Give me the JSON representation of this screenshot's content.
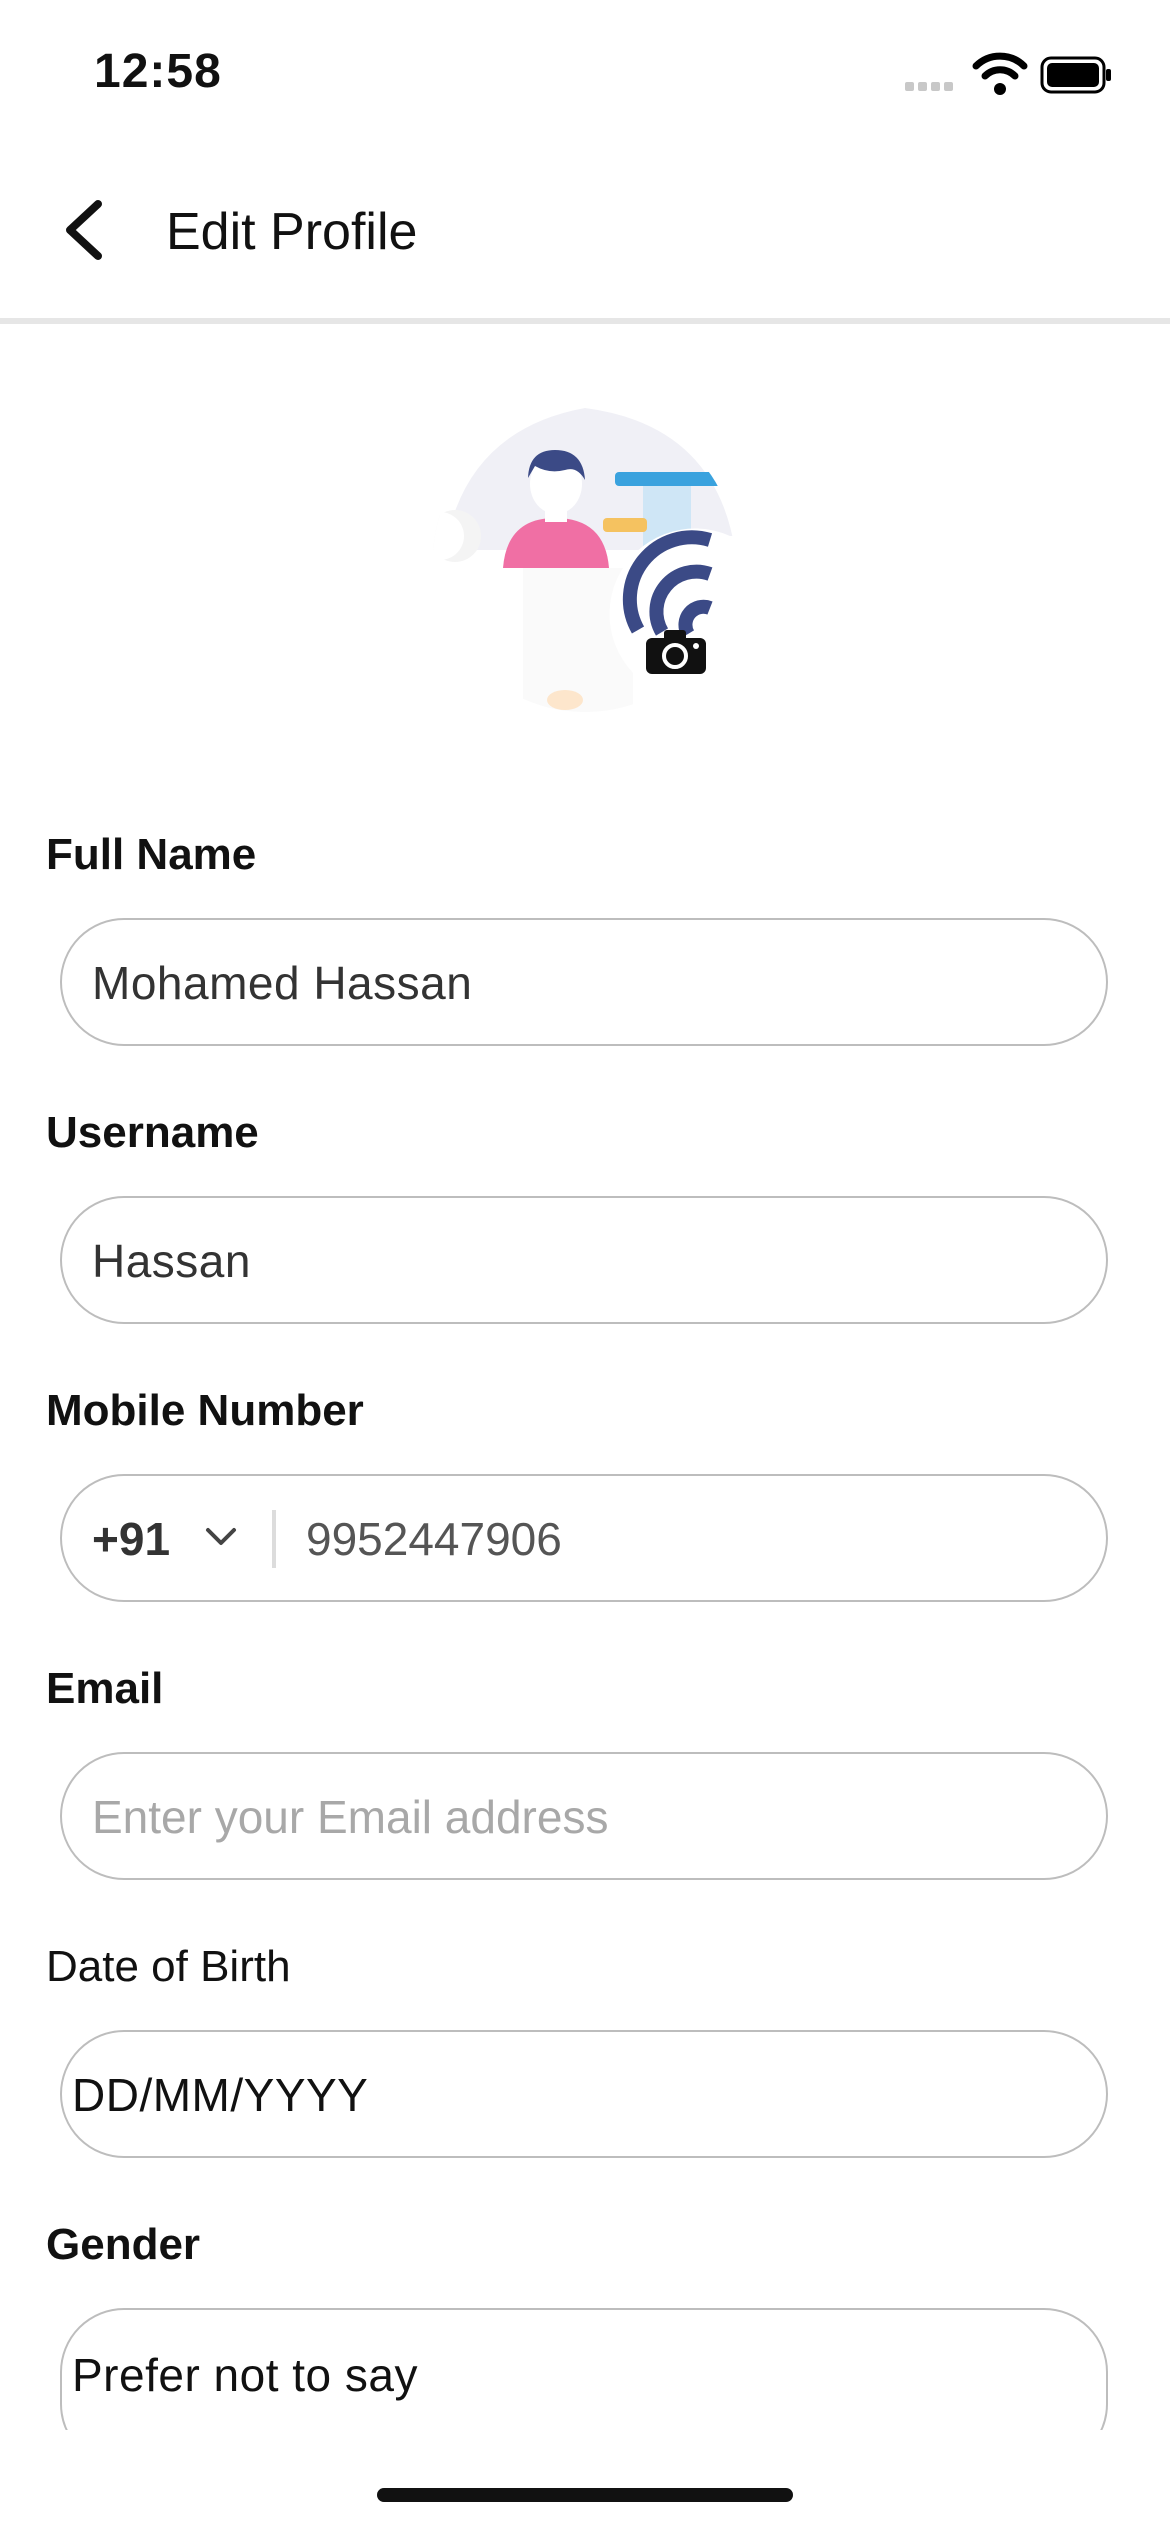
{
  "status": {
    "time": "12:58"
  },
  "header": {
    "title": "Edit Profile"
  },
  "form": {
    "full_name": {
      "label": "Full Name",
      "value": "Mohamed Hassan"
    },
    "username": {
      "label": "Username",
      "value": "Hassan"
    },
    "mobile": {
      "label": "Mobile Number",
      "country_code": "+91",
      "value": "9952447906"
    },
    "email": {
      "label": "Email",
      "placeholder": "Enter your Email address"
    },
    "dob": {
      "label": "Date of Birth",
      "value": "DD/MM/YYYY"
    },
    "gender": {
      "label": "Gender",
      "value": "Prefer not to say"
    }
  },
  "colors": {
    "accent_navy": "#3b4a86",
    "avatar_shirt": "#f06fa4",
    "border": "#bdbdbd"
  },
  "icons": [
    "back-arrow-icon",
    "camera-icon",
    "chevron-down-icon",
    "wifi-icon",
    "battery-icon"
  ]
}
